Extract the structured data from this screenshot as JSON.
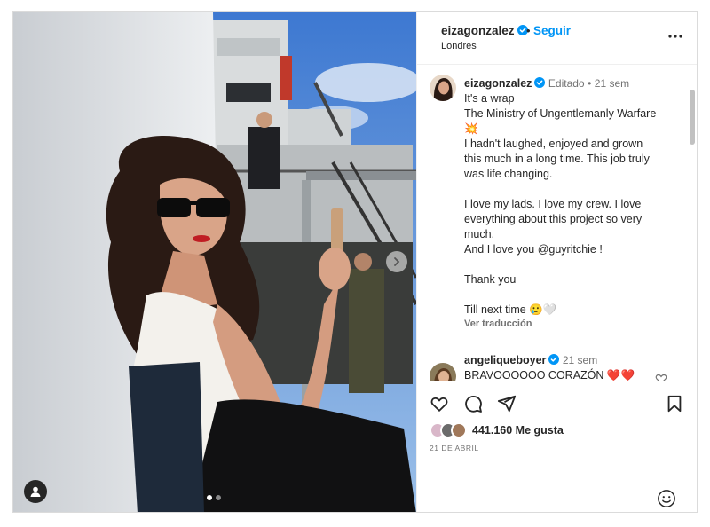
{
  "post": {
    "username": "eizagonzalez",
    "separator": "•",
    "follow_label": "Seguir",
    "location": "Londres"
  },
  "caption": {
    "username": "eizagonzalez",
    "edited": "Editado",
    "time": "21 sem",
    "lines": [
      "It's a wrap",
      "The Ministry of Ungentlemanly Warfare",
      "💥",
      "I hadn't laughed, enjoyed and grown",
      "this much in a long time. This job truly",
      "was life changing.",
      "",
      "I love my lads. I love my crew. I love",
      "everything about this project so very",
      "much.",
      "And I love you @guyritchie !",
      "",
      "Thank you",
      "",
      "Till next time 🥲🤍"
    ],
    "translate_label": "Ver traducción"
  },
  "comment": {
    "username": "angeliqueboyer",
    "time": "21 sem",
    "text": "BRAVOOOOOO CORAZÓN ❤️❤️"
  },
  "engagement": {
    "likes": "441.160 Me gusta",
    "date": "21 DE ABRIL"
  },
  "icons": {
    "verified": "verified-badge-icon",
    "more": "more-options-icon",
    "like": "heart-icon",
    "comment": "comment-icon",
    "share": "share-icon",
    "save": "bookmark-icon",
    "emoji": "emoji-icon",
    "user_tag": "user-tag-icon",
    "next": "chevron-right-icon"
  },
  "colors": {
    "link_blue": "#0095f6",
    "verified_blue": "#0095f6",
    "muted": "#737373",
    "text": "#262626"
  },
  "carousel": {
    "total": 2,
    "active": 1
  }
}
